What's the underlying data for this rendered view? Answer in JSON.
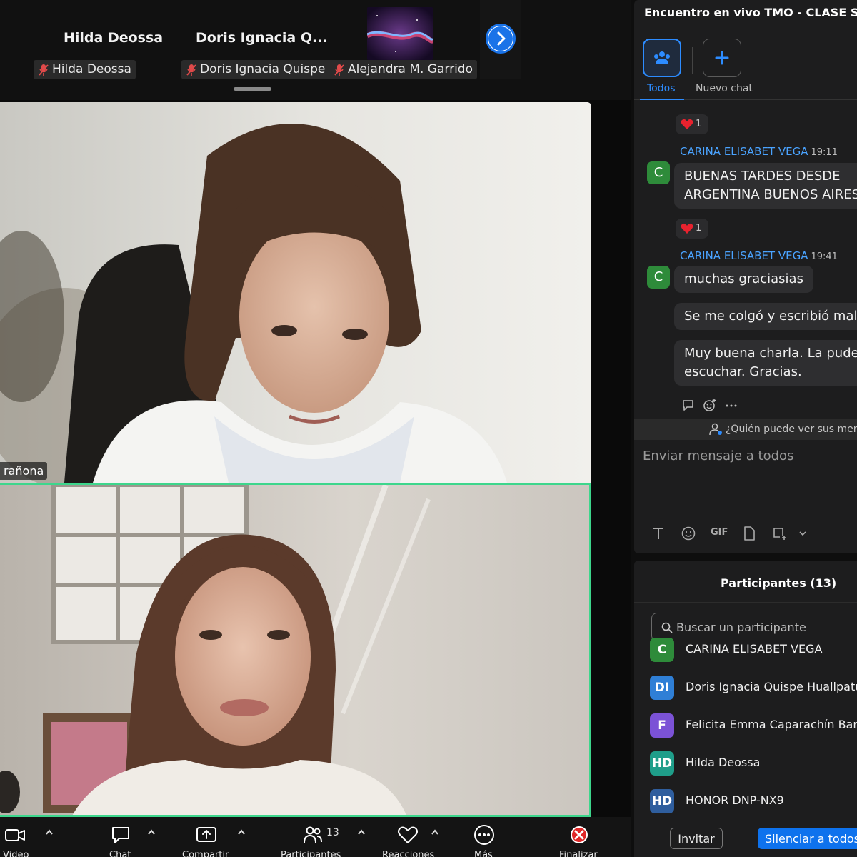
{
  "participant_strip": {
    "thumbnails": [
      {
        "name": "Hilda Deossa",
        "tag": "Hilda Deossa"
      },
      {
        "name": "Doris Ignacia Q...",
        "tag": "Doris Ignacia Quispe ..."
      },
      {
        "name": "",
        "tag": "Alejandra M. Garrido"
      }
    ]
  },
  "video_tiles": [
    {
      "label": "rañona",
      "active_speaker": false
    },
    {
      "label": "",
      "active_speaker": true
    }
  ],
  "toolbar": {
    "items": [
      {
        "label": "Video",
        "icon": "video-camera-icon",
        "has_caret": true
      },
      {
        "label": "Chat",
        "icon": "chat-bubble-icon",
        "has_caret": true
      },
      {
        "label": "Compartir",
        "icon": "share-screen-icon",
        "has_caret": true
      },
      {
        "label": "Participantes",
        "icon": "participants-icon",
        "count": "13",
        "has_caret": true
      },
      {
        "label": "Reacciones",
        "icon": "heart-icon",
        "has_caret": true
      },
      {
        "label": "Más",
        "icon": "more-icon",
        "has_caret": false
      },
      {
        "label": "Finalizar",
        "icon": "end-meeting-icon",
        "has_caret": false
      }
    ]
  },
  "chat": {
    "title": "Encuentro en vivo TMO - CLASE SINC",
    "tabs": {
      "all": "Todos",
      "new_chat": "Nuevo chat"
    },
    "messages": [
      {
        "reaction_count": "1"
      },
      {
        "sender": "CARINA ELISABET VEGA",
        "time": "19:11",
        "avatar": "C",
        "lines": [
          "BUENAS TARDES DESDE",
          "ARGENTINA BUENOS AIRES."
        ],
        "reaction_count": "1"
      },
      {
        "sender": "CARINA ELISABET VEGA",
        "time": "19:41",
        "avatar": "C",
        "bubbles": [
          {
            "lines": [
              "muchas graciasias"
            ]
          },
          {
            "lines": [
              "Se me colgó y escribió mal."
            ]
          },
          {
            "lines": [
              "Muy buena charla. La pude",
              "escuchar. Gracias."
            ]
          }
        ]
      }
    ],
    "who_can_see": "¿Quién puede ver sus mens",
    "compose_placeholder": "Enviar mensaje a todos",
    "compose_tools": {
      "gif": "GIF"
    }
  },
  "participants": {
    "title": "Participantes (13)",
    "search_placeholder": "Buscar un participante",
    "list": [
      {
        "initials": "C",
        "name": "CARINA ELISABET VEGA",
        "color": "#2e8b3a"
      },
      {
        "initials": "DI",
        "name": "Doris Ignacia Quispe Huallpatue",
        "color": "#2f7fd6"
      },
      {
        "initials": "F",
        "name": "Felicita Emma Caparachín Barret",
        "color": "#7b52d6"
      },
      {
        "initials": "HD",
        "name": "Hilda Deossa",
        "color": "#1f9e8a"
      },
      {
        "initials": "HD",
        "name": "HONOR DNP-NX9",
        "color": "#2f5e9e"
      }
    ],
    "invite_label": "Invitar",
    "mute_all_label": "Silenciar a todos"
  },
  "colors": {
    "accent": "#2d8cff",
    "active_speaker_border": "#3dd68c",
    "end_red": "#e02828",
    "mute_button": "#0e72ed"
  }
}
